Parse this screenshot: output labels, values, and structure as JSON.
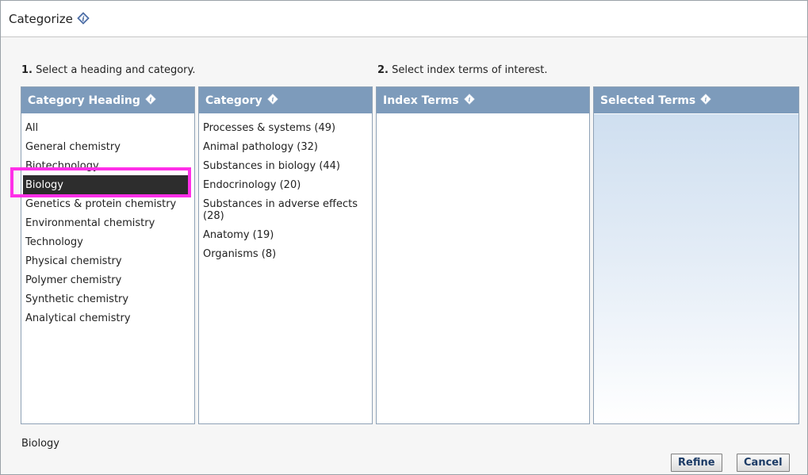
{
  "dialog": {
    "title": "Categorize"
  },
  "steps": {
    "step1_num": "1.",
    "step1_text": "Select a heading and category.",
    "step2_num": "2.",
    "step2_text": "Select index terms of interest."
  },
  "panels": {
    "heading": {
      "title": "Category Heading",
      "items": [
        "All",
        "General chemistry",
        "Biotechnology",
        "Biology",
        "Genetics & protein chemistry",
        "Environmental chemistry",
        "Technology",
        "Physical chemistry",
        "Polymer chemistry",
        "Synthetic chemistry",
        "Analytical chemistry"
      ],
      "selected": "Biology"
    },
    "category": {
      "title": "Category",
      "items": [
        "Processes & systems (49)",
        "Animal pathology (32)",
        "Substances in biology (44)",
        "Endocrinology (20)",
        "Substances in adverse effects (28)",
        "Anatomy (19)",
        "Organisms (8)"
      ]
    },
    "index_terms": {
      "title": "Index Terms"
    },
    "selected_terms": {
      "title": "Selected Terms"
    }
  },
  "status": "Biology",
  "buttons": {
    "refine": "Refine",
    "cancel": "Cancel"
  },
  "colors": {
    "header_bg": "#7d9bbb",
    "highlight": "#ff2fe8",
    "selected_bg": "#2d2d2d"
  },
  "icons": {
    "info": "info-diamond-icon"
  }
}
